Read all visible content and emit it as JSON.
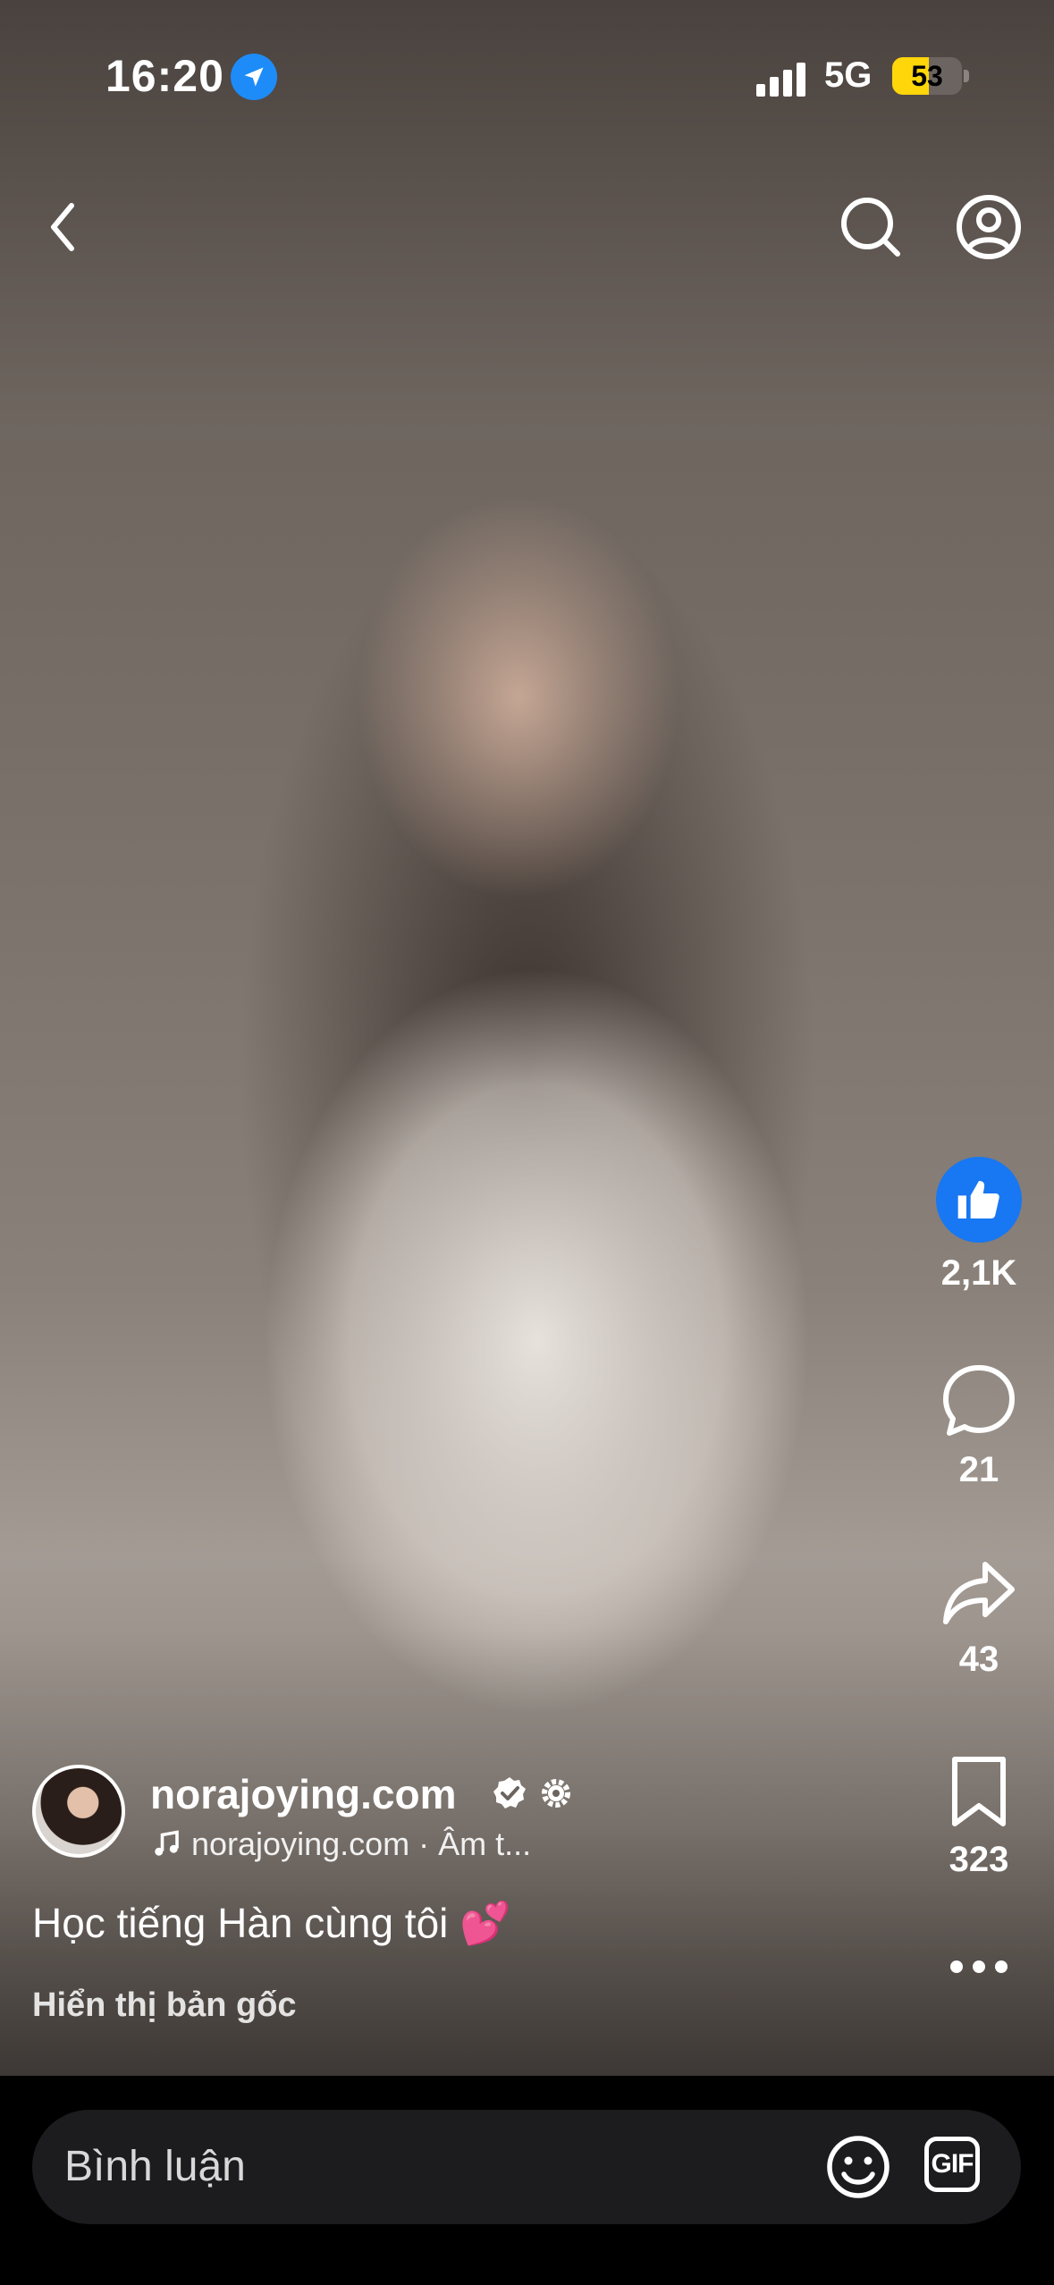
{
  "status_bar": {
    "time": "16:20",
    "network": "5G",
    "battery": "53",
    "battery_level_percent": 53
  },
  "top_nav": {
    "back_icon": "chevron-left-icon",
    "search_icon": "search-icon",
    "profile_icon": "user-circle-icon"
  },
  "actions": {
    "like_count": "2,1K",
    "comment_count": "21",
    "share_count": "43",
    "save_count": "323",
    "like_color": "#1877f2"
  },
  "post": {
    "author_name": "norajoying.com",
    "music_text": "norajoying.com · Âm t...",
    "caption_text": "Học tiếng Hàn cùng tôi",
    "caption_emoji": "💕",
    "show_original": "Hiển thị bản gốc"
  },
  "comment_bar": {
    "placeholder": "Bình luận",
    "gif_label": "GIF"
  }
}
